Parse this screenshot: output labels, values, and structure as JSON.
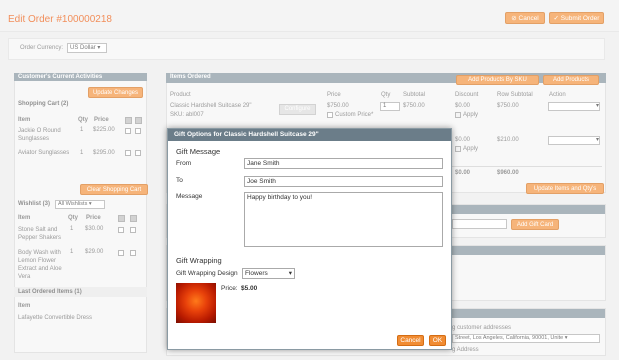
{
  "page": {
    "title": "Edit Order #100000218",
    "cancel": "Cancel",
    "submit": "Submit Order",
    "currency_label": "Order Currency:",
    "currency_value": "US Dollar"
  },
  "activities": {
    "title": "Customer's Current Activities",
    "update_button": "Update Changes",
    "cart_title": "Shopping Cart (2)",
    "cols": [
      "Item",
      "Qty",
      "Price"
    ],
    "cart_items": [
      {
        "name": "Jackie O Round Sunglasses",
        "qty": "1",
        "price": "$225.00"
      },
      {
        "name": "Aviator Sunglasses",
        "qty": "1",
        "price": "$295.00"
      }
    ],
    "clear_cart": "Clear Shopping Cart",
    "wishlist_title": "Wishlist (3)",
    "wishlist_select": "All Wishlists",
    "wishlist_cols": [
      "Item",
      "Qty",
      "Price"
    ],
    "wishlist_items": [
      {
        "name": "Stone Salt and Pepper Shakers",
        "qty": "1",
        "price": "$30.00"
      },
      {
        "name": "Body Wash with Lemon Flower Extract and Aloe Vera",
        "qty": "1",
        "price": "$29.00"
      }
    ],
    "last_ordered_title": "Last Ordered Items (1)",
    "last_ordered_col": "Item",
    "last_ordered_item": "Lafayette Convertible Dress"
  },
  "items_ordered": {
    "title": "Items Ordered",
    "add_sku": "Add Products By SKU",
    "add_products": "Add Products",
    "cols": [
      "Product",
      "Price",
      "Qty",
      "Subtotal",
      "Discount",
      "Row Subtotal",
      "Action"
    ],
    "row1": {
      "name": "Classic Hardshell Suitcase 29\"",
      "sku": "SKU: abl007",
      "configure": "Configure",
      "price": "$750.00",
      "custom_price": "Custom Price*",
      "qty": "1",
      "subtotal": "$750.00",
      "discount": "$0.00",
      "apply": "Apply",
      "row_subtotal": "$750.00"
    },
    "row2": {
      "discount": "$0.00",
      "apply": "Apply",
      "row_subtotal": "$210.00"
    },
    "totals": {
      "discount": "$0.00",
      "row_subtotal": "$960.00"
    },
    "update_button": "Update Items and Qty's",
    "add_gift_card": "Add Gift Card",
    "address_fragment": "g customer addresses",
    "address_line": "Street, Los Angeles, California, 90001, Unite",
    "ship_same": "g Address"
  },
  "modal": {
    "title": "Gift Options for Classic Hardshell Suitcase 29\"",
    "gift_message": "Gift Message",
    "from_label": "From",
    "from_value": "Jane Smith",
    "to_label": "To",
    "to_value": "Joe Smith",
    "message_label": "Message",
    "message_value": "Happy birthday to you!",
    "gift_wrapping": "Gift Wrapping",
    "design_label": "Gift Wrapping Design",
    "design_value": "Flowers",
    "price_label": "Price:",
    "price_value": "$5.00",
    "cancel": "Cancel",
    "ok": "OK"
  },
  "colors": {
    "accent": "#eb5202",
    "button": "#f18c33",
    "header": "#6b7d89"
  }
}
